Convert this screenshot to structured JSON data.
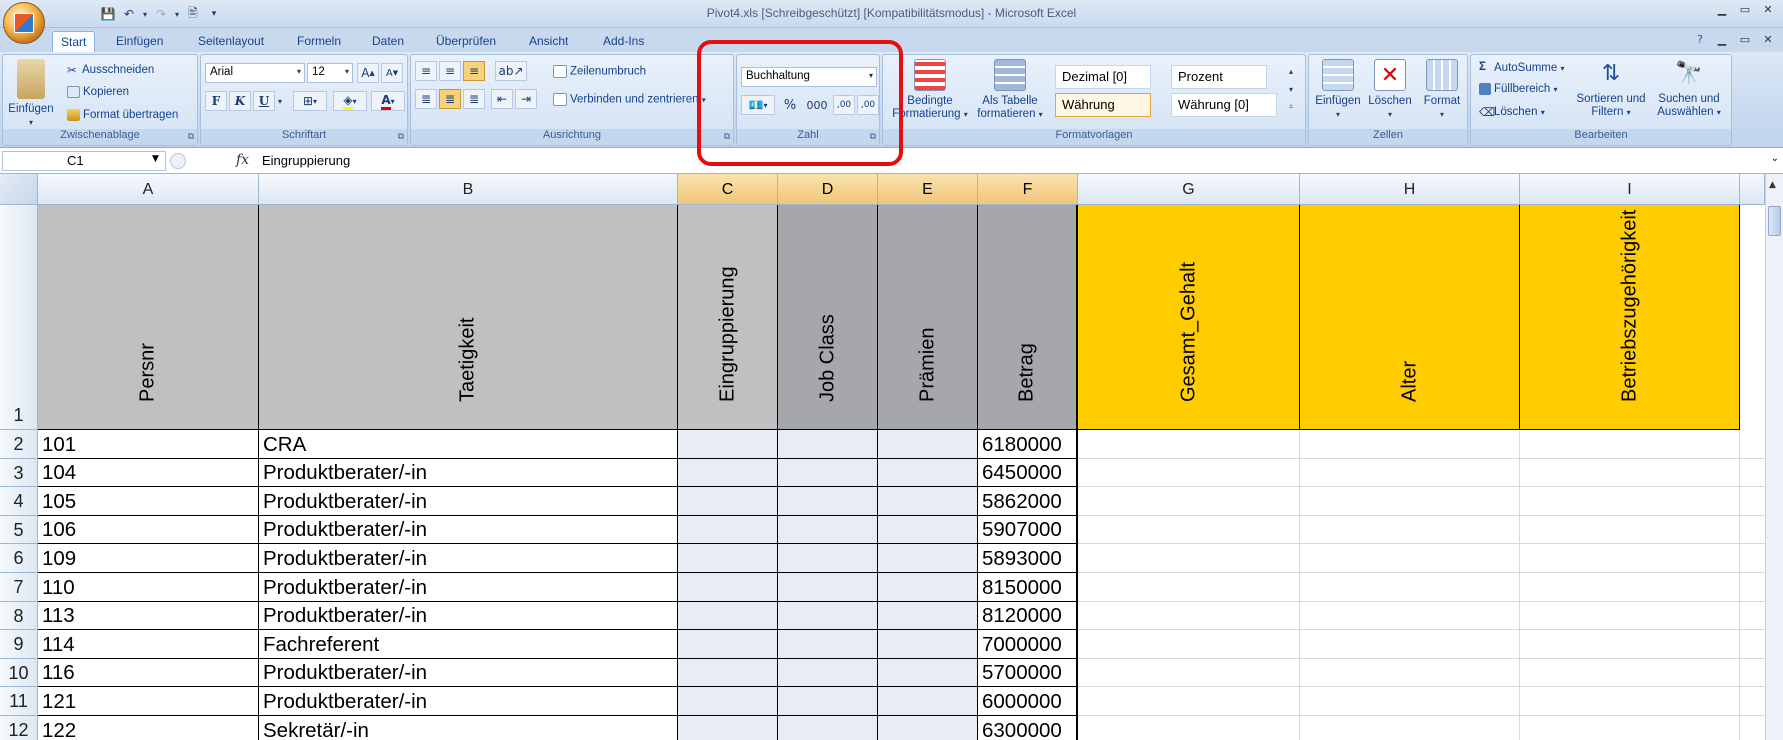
{
  "window": {
    "title": "Pivot4.xls  [Schreibgeschützt]  [Kompatibilitätsmodus] - Microsoft Excel"
  },
  "tabs": [
    "Start",
    "Einfügen",
    "Seitenlayout",
    "Formeln",
    "Daten",
    "Überprüfen",
    "Ansicht",
    "Add-Ins"
  ],
  "ribbon": {
    "clipboard": {
      "label": "Zwischenablage",
      "paste": "Einfügen",
      "cut": "Ausschneiden",
      "copy": "Kopieren",
      "format_painter": "Format übertragen"
    },
    "font": {
      "label": "Schriftart",
      "name": "Arial",
      "size": "12",
      "bold": "F",
      "italic": "K",
      "underline": "U"
    },
    "alignment": {
      "label": "Ausrichtung",
      "wrap": "Zeilenumbruch",
      "merge": "Verbinden und zentrieren"
    },
    "number": {
      "label": "Zahl",
      "format": "Buchhaltung",
      "percent": "%",
      "thousands": "000",
      "inc_dec": ",00",
      "dec_dec": ",00"
    },
    "styles": {
      "label": "Formatvorlagen",
      "conditional": "Bedingte Formatierung",
      "as_table": "Als Tabelle formatieren",
      "style_cells": [
        "Dezimal [0]",
        "Prozent",
        "Währung",
        "Währung [0]"
      ]
    },
    "cells": {
      "label": "Zellen",
      "insert": "Einfügen",
      "delete": "Löschen",
      "format": "Format"
    },
    "editing": {
      "label": "Bearbeiten",
      "autosum": "AutoSumme",
      "fill": "Füllbereich",
      "clear": "Löschen",
      "sort": "Sortieren und Filtern",
      "find": "Suchen und Auswählen"
    }
  },
  "formula_bar": {
    "name_box": "C1",
    "fx": "fx",
    "content": "Eingruppierung"
  },
  "columns": [
    "A",
    "B",
    "C",
    "D",
    "E",
    "F",
    "G",
    "H",
    "I"
  ],
  "header_row": {
    "row": "1",
    "cells": [
      "Persnr",
      "Taetigkeit",
      "Eingruppierung",
      "Job Class",
      "Prämien",
      "Betrag",
      "Gesamt_Gehalt",
      "Alter",
      "Betriebszugehörigkeit"
    ]
  },
  "rows": [
    {
      "row": "2",
      "persnr": "101",
      "taetigkeit": "CRA",
      "betrag": "6180000"
    },
    {
      "row": "3",
      "persnr": "104",
      "taetigkeit": "Produktberater/-in",
      "betrag": "6450000"
    },
    {
      "row": "4",
      "persnr": "105",
      "taetigkeit": "Produktberater/-in",
      "betrag": "5862000"
    },
    {
      "row": "5",
      "persnr": "106",
      "taetigkeit": "Produktberater/-in",
      "betrag": "5907000"
    },
    {
      "row": "6",
      "persnr": "109",
      "taetigkeit": "Produktberater/-in",
      "betrag": "5893000"
    },
    {
      "row": "7",
      "persnr": "110",
      "taetigkeit": "Produktberater/-in",
      "betrag": "8150000"
    },
    {
      "row": "8",
      "persnr": "113",
      "taetigkeit": "Produktberater/-in",
      "betrag": "8120000"
    },
    {
      "row": "9",
      "persnr": "114",
      "taetigkeit": "Fachreferent",
      "betrag": "7000000"
    },
    {
      "row": "10",
      "persnr": "116",
      "taetigkeit": "Produktberater/-in",
      "betrag": "5700000"
    },
    {
      "row": "11",
      "persnr": "121",
      "taetigkeit": "Produktberater/-in",
      "betrag": "6000000"
    },
    {
      "row": "12",
      "persnr": "122",
      "taetigkeit": "Sekretär/-in",
      "betrag": "6300000"
    }
  ],
  "colors": {
    "header_gray": "#c0c0c0",
    "header_dark_gray": "#a6a7ab",
    "header_yellow": "#ffcc00",
    "selected_col": "#e8ecf4",
    "highlight": "#e21010"
  }
}
